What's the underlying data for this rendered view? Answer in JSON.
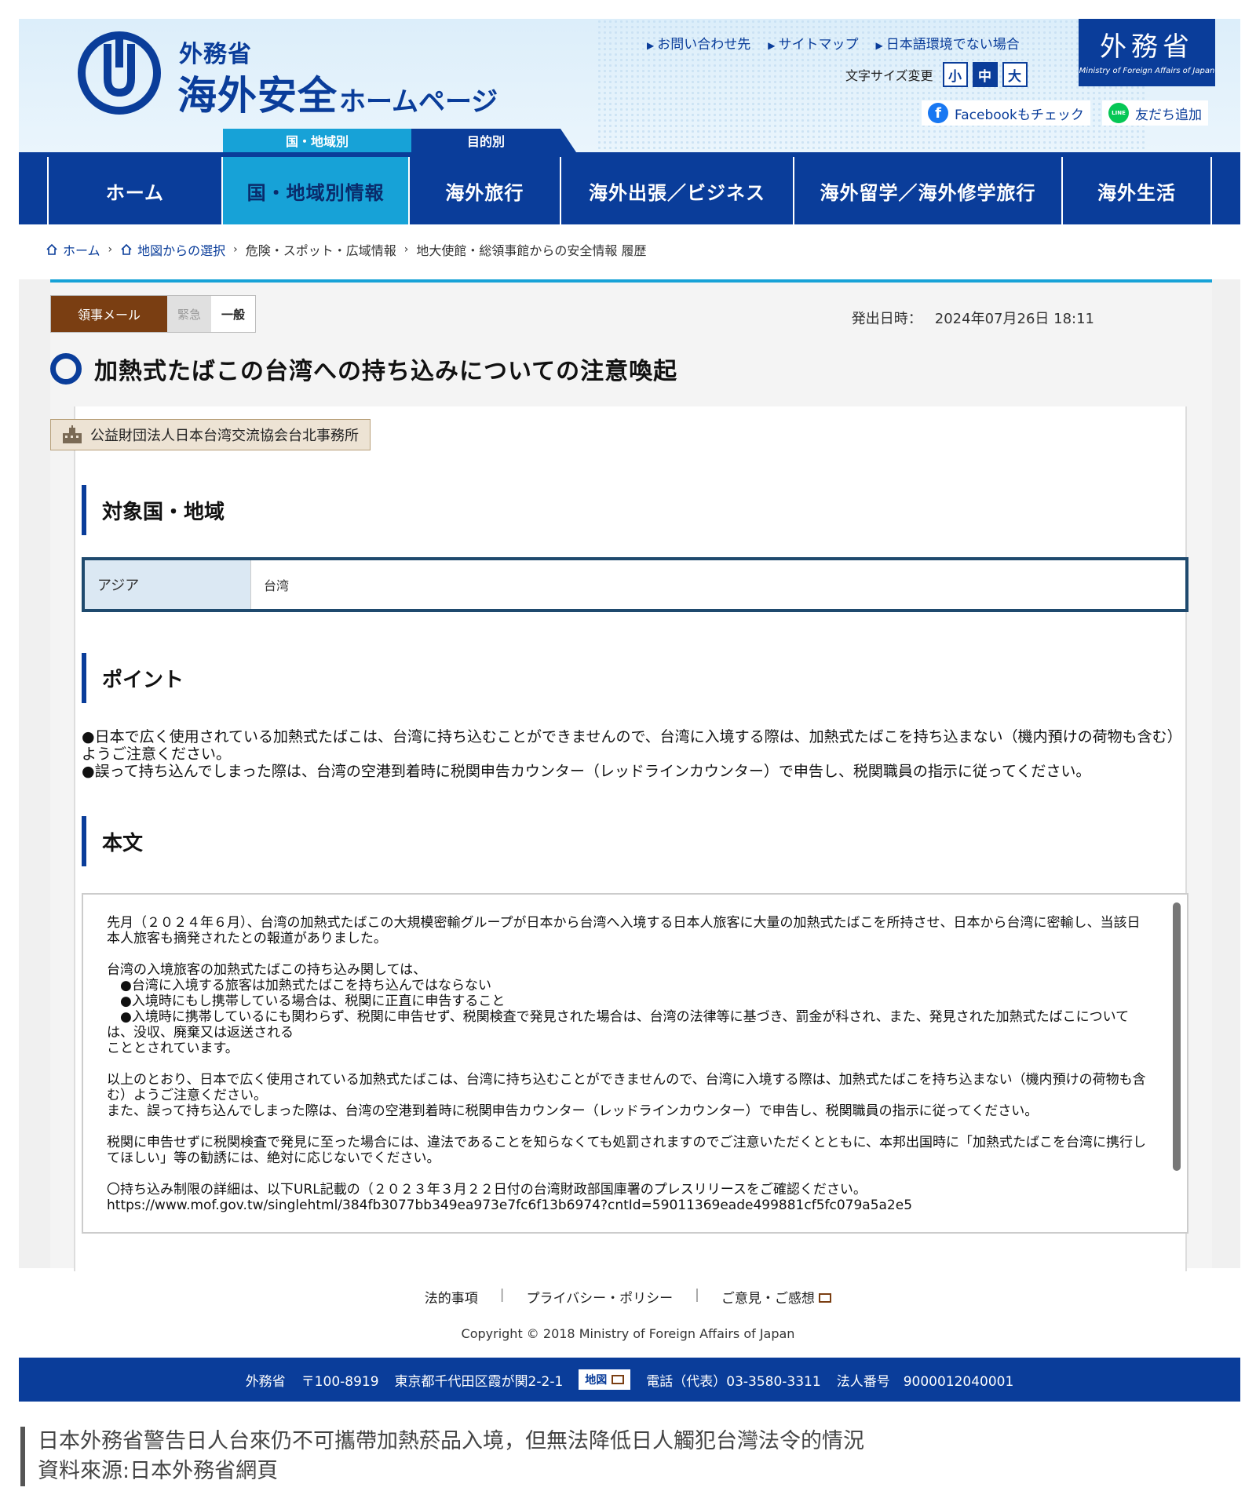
{
  "header": {
    "logo_small": "外務省",
    "logo_big": "海外安全",
    "logo_sub": "ホームページ",
    "top_links": [
      "お問い合わせ先",
      "サイトマップ",
      "日本語環境でない場合"
    ],
    "font_size_label": "文字サイズ変更",
    "font_sizes": [
      "小",
      "中",
      "大"
    ],
    "mofa_kanji": "外務省",
    "mofa_en": "Ministry of Foreign Affairs of Japan",
    "facebook_label": "Facebookもチェック",
    "line_label": "友だち追加",
    "line_icon_text": "LINE",
    "cat_country": "国・地域別",
    "cat_purpose": "目的別"
  },
  "nav": {
    "items": [
      "ホーム",
      "国・地域別情報",
      "海外旅行",
      "海外出張／ビジネス",
      "海外留学／海外修学旅行",
      "海外生活"
    ],
    "active_index": 1
  },
  "breadcrumb": {
    "items": [
      "ホーム",
      "地図からの選択",
      "危険・スポット・広域情報",
      "地大使館・総領事館からの安全情報 履歴"
    ]
  },
  "article": {
    "tags": [
      "領事メール",
      "緊急",
      "一般"
    ],
    "issued_label": "発出日時：",
    "issued_value": "2024年07月26日 18:11",
    "title": "加熱式たばこの台湾への持ち込みについての注意喚起",
    "organization": "公益財団法人日本台湾交流協会台北事務所",
    "section_region": "対象国・地域",
    "region_key": "アジア",
    "region_value": "台湾",
    "section_points": "ポイント",
    "points": [
      "●日本で広く使用されている加熱式たばこは、台湾に持ち込むことができませんので、台湾に入境する際は、加熱式たばこを持ち込まない（機内預けの荷物も含む）ようご注意ください。",
      "●誤って持ち込んでしまった際は、台湾の空港到着時に税関申告カウンター（レッドラインカウンター）で申告し、税関職員の指示に従ってください。"
    ],
    "section_body": "本文",
    "body": "先月（２０２４年６月）、台湾の加熱式たばこの大規模密輸グループが日本から台湾へ入境する日本人旅客に大量の加熱式たばこを所持させ、日本から台湾に密輸し、当該日本人旅客も摘発されたとの報道がありました。\n\n台湾の入境旅客の加熱式たばこの持ち込み関しては、\n　●台湾に入境する旅客は加熱式たばこを持ち込んではならない\n　●入境時にもし携帯している場合は、税関に正直に申告すること\n　●入境時に携帯しているにも関わらず、税関に申告せず、税関検査で発見された場合は、台湾の法律等に基づき、罰金が科され、また、発見された加熱式たばこについては、没収、廃棄又は返送される\nこととされています。\n\n以上のとおり、日本で広く使用されている加熱式たばこは、台湾に持ち込むことができませんので、台湾に入境する際は、加熱式たばこを持ち込まない（機内預けの荷物も含む）ようご注意ください。\nまた、誤って持ち込んでしまった際は、台湾の空港到着時に税関申告カウンター（レッドラインカウンター）で申告し、税関職員の指示に従ってください。\n\n税関に申告せずに税関検査で発見に至った場合には、違法であることを知らなくても処罰されますのでご注意いただくとともに、本邦出国時に「加熱式たばこを台湾に携行してほしい」等の勧誘には、絶対に応じないでください。\n\n〇持ち込み制限の詳細は、以下URL記載の（２０２３年３月２２日付の台湾財政部国庫署のプレスリリースをご確認ください。\nhttps://www.mof.gov.tw/singlehtml/384fb3077bb349ea973e7fc6f13b6974?cntId=59011369eade499881cf5fc079a5a2e5"
  },
  "footer": {
    "links": [
      "法的事項",
      "プライバシー・ポリシー",
      "ご意見・ご感想"
    ],
    "copyright": "Copyright © 2018 Ministry of Foreign Affairs of Japan",
    "address": {
      "org": "外務省",
      "postal": "〒100-8919",
      "addr": "東京都千代田区霞が関2-2-1",
      "map": "地図",
      "phone": "電話（代表）03-3580-3311",
      "corp": "法人番号　9000012040001"
    }
  },
  "caption": {
    "line1": "日本外務省警告日人台來仍不可攜帶加熱菸品入境，但無法降低日人觸犯台灣法令的情況",
    "line2": "資料來源:日本外務省網頁"
  },
  "colors": {
    "brand_navy": "#0a3d9a",
    "accent_cyan": "#17a2d7",
    "tag_brown": "#7a3e12"
  }
}
